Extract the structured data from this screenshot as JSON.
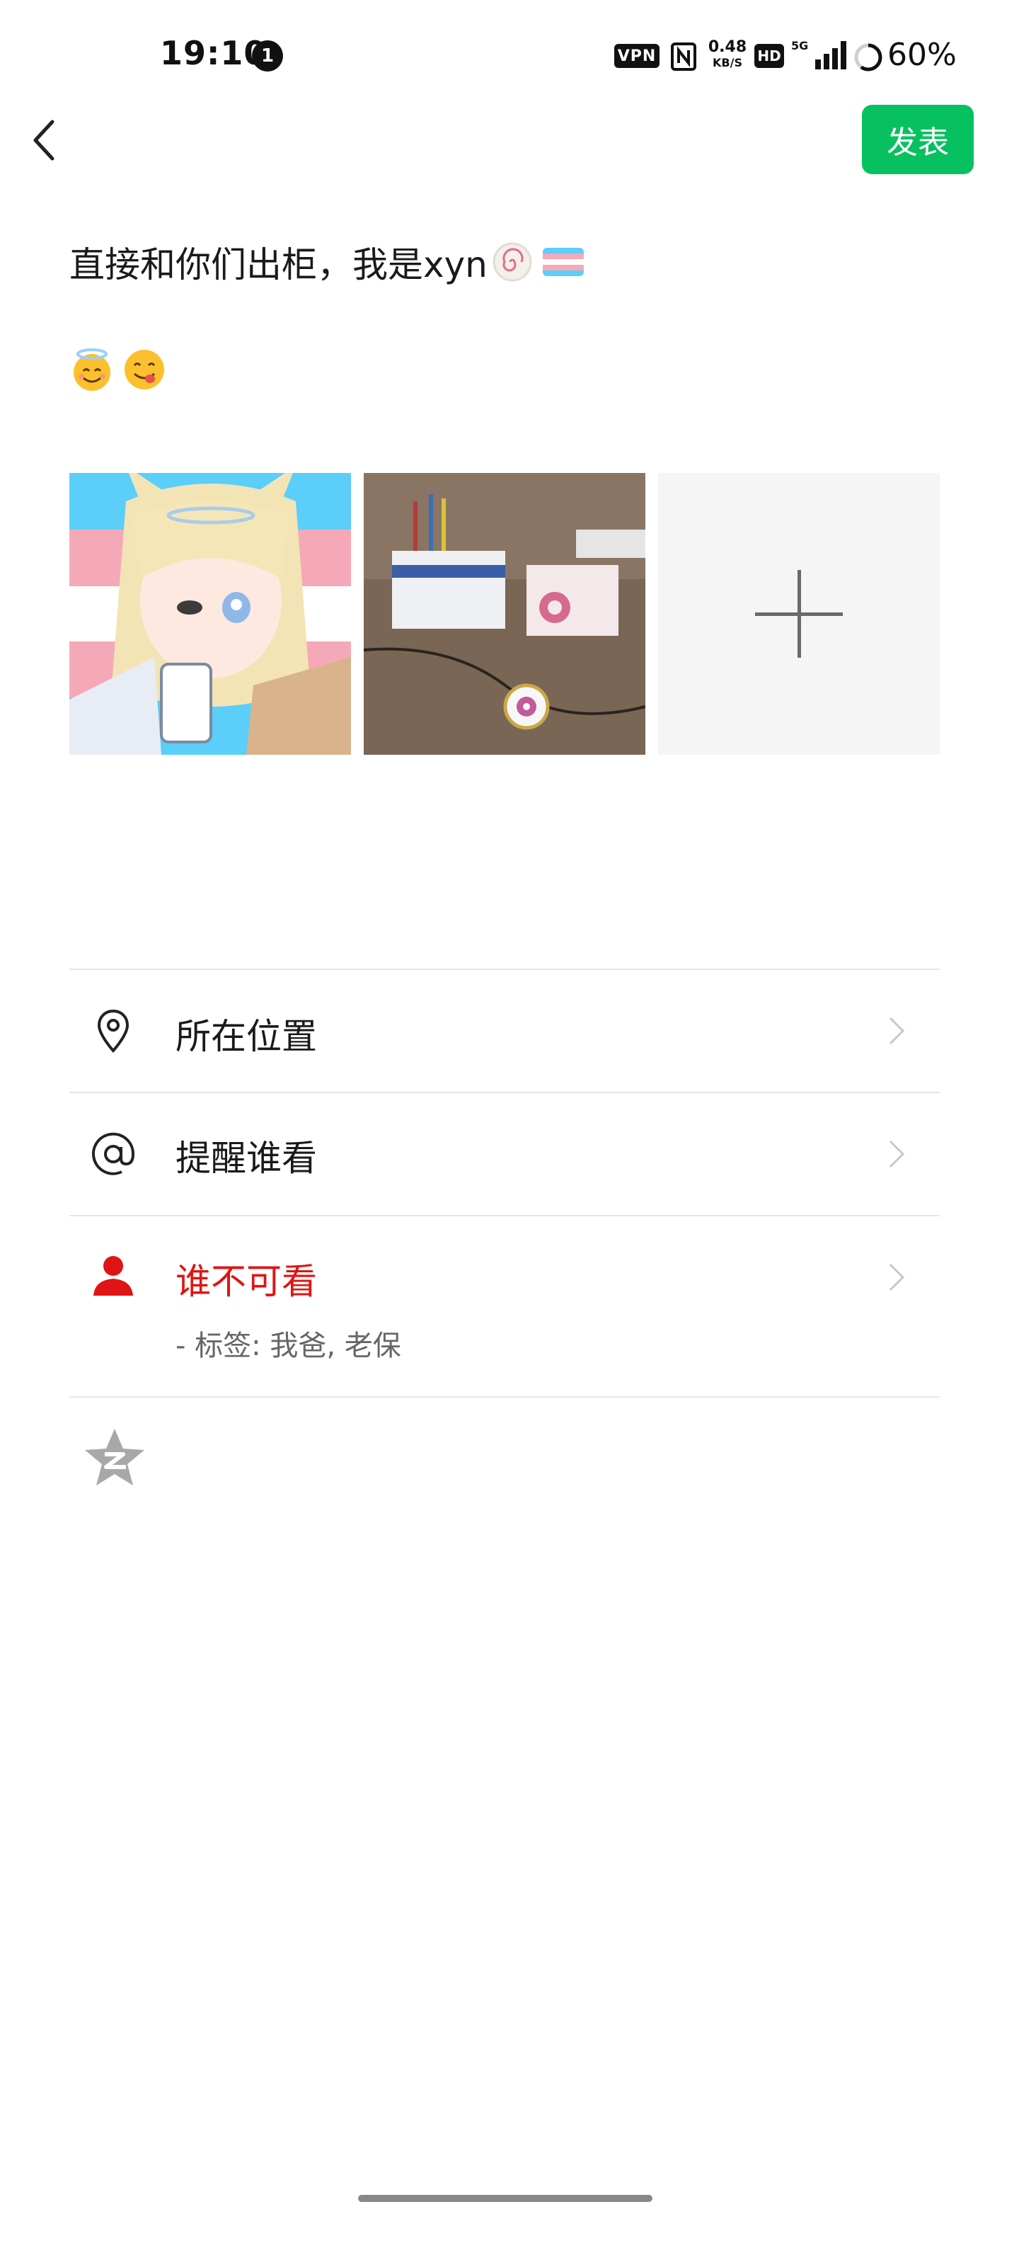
{
  "status_bar": {
    "time": "19:10",
    "notification_count": "1",
    "vpn": "VPN",
    "speed_value": "0.48",
    "speed_unit": "KB/S",
    "hd": "HD",
    "network": "5G",
    "battery": "60%"
  },
  "header": {
    "publish_label": "发表",
    "accent_color": "#07c160"
  },
  "post": {
    "text": "直接和你们出柜，我是xyn"
  },
  "images": [
    {
      "description_icon": "anime-character-image"
    },
    {
      "description_icon": "medicine-photo-image"
    },
    {
      "description_icon": "add-image-plus-icon"
    }
  ],
  "options": {
    "location_label": "所在位置",
    "mention_label": "提醒谁看",
    "hidden_from_label": "谁不可看",
    "hidden_from_detail": "- 标签: 我爸, 老保",
    "hidden_from_color": "#e01414"
  }
}
